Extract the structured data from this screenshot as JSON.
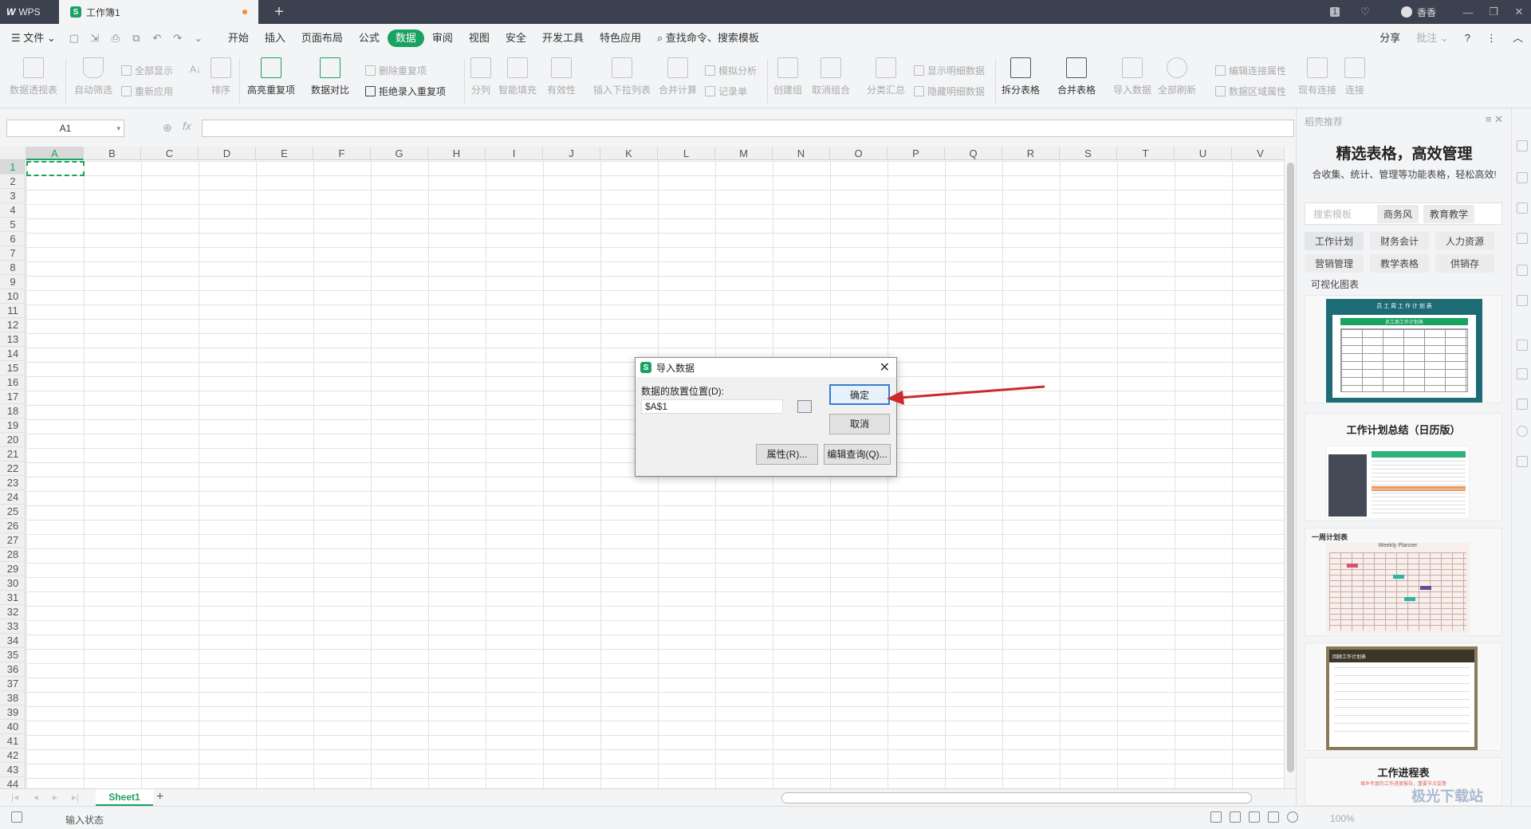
{
  "titlebar": {
    "wps_label": "WPS",
    "doc_tab": "工作簿1",
    "s_glyph": "S",
    "add_tab": "+",
    "user": "香香",
    "page_badge": "1"
  },
  "menu": {
    "file": "文件",
    "items": [
      "开始",
      "插入",
      "页面布局",
      "公式",
      "数据",
      "审阅",
      "视图",
      "安全",
      "开发工具",
      "特色应用"
    ],
    "active": "数据",
    "search": "查找命令、搜索模板",
    "share": "分享",
    "annotate": "批注",
    "help": "?"
  },
  "ribbon": {
    "pivot": "数据透视表",
    "autofilter": "自动筛选",
    "show_all": "全部显示",
    "reapply": "重新应用",
    "sort_az": "A↓",
    "sort": "排序",
    "highlight_dup": "高亮重复项",
    "data_compare": "数据对比",
    "delete_dup": "删除重复项",
    "reject_dup": "拒绝录入重复项",
    "split": "分列",
    "smart_fill": "智能填充",
    "validity": "有效性",
    "insert_dropdown": "插入下拉列表",
    "merge_calc": "合并计算",
    "simulate": "模拟分析",
    "record": "记录单",
    "create_group": "创建组",
    "ungroup": "取消组合",
    "subtotal": "分类汇总",
    "show_detail": "显示明细数据",
    "hide_detail": "隐藏明细数据",
    "split_table": "拆分表格",
    "merge_table": "合并表格",
    "import_data": "导入数据",
    "refresh_all": "全部刷新",
    "edit_link": "编辑连接属性",
    "data_range_prop": "数据区域属性",
    "existing_conn": "现有连接",
    "connect": "连接"
  },
  "formula_bar": {
    "name_box": "A1",
    "fx": "fx",
    "formula": ""
  },
  "grid": {
    "columns": [
      "A",
      "B",
      "C",
      "D",
      "E",
      "F",
      "G",
      "H",
      "I",
      "J",
      "K",
      "L",
      "M",
      "N",
      "O",
      "P",
      "Q",
      "R",
      "S",
      "T",
      "U",
      "V"
    ],
    "rows": [
      "1",
      "2",
      "3",
      "4",
      "5",
      "6",
      "7",
      "8",
      "9",
      "10",
      "11",
      "12",
      "13",
      "14",
      "15",
      "16",
      "17",
      "18",
      "19",
      "20",
      "21",
      "22",
      "23",
      "24",
      "25",
      "26",
      "27",
      "28",
      "29",
      "30",
      "31",
      "32",
      "33",
      "34",
      "35",
      "36",
      "37",
      "38",
      "39",
      "40",
      "41",
      "42",
      "43",
      "44"
    ],
    "selected": "A1"
  },
  "sheets": {
    "active": "Sheet1",
    "add": "+"
  },
  "status": {
    "text": "输入状态",
    "zoom": "100%"
  },
  "sidebar": {
    "header": "稻壳推荐",
    "title": "精选表格，高效管理",
    "subtitle": "合收集、统计、管理等功能表格，轻松高效!",
    "search_placeholder": "搜索模板",
    "search_tags": [
      "商务风",
      "教育教学"
    ],
    "chips_row1": [
      "工作计划",
      "财务会计",
      "人力资源"
    ],
    "chips_row2": [
      "营销管理",
      "教学表格",
      "供销存"
    ],
    "category": "可视化图表",
    "cards": [
      "",
      "工作计划总结（日历版）",
      "一周计划表",
      "",
      "工作进程表"
    ],
    "card1_header": "员 工 周 工 作 计 划 表",
    "card1_sub": "员工周工作计划表",
    "card3_sub": "Weekly  Planner",
    "card4_header": "回顾工作计划表",
    "card5_sub": "城乡年度的工作进度报告，重要节点监督"
  },
  "dialog": {
    "title": "导入数据",
    "label": "数据的放置位置(D):",
    "value": "$A$1",
    "ok": "确定",
    "cancel": "取消",
    "properties": "属性(R)...",
    "edit_query": "编辑查询(Q)...",
    "close": "✕"
  },
  "watermark": "极光下载站"
}
